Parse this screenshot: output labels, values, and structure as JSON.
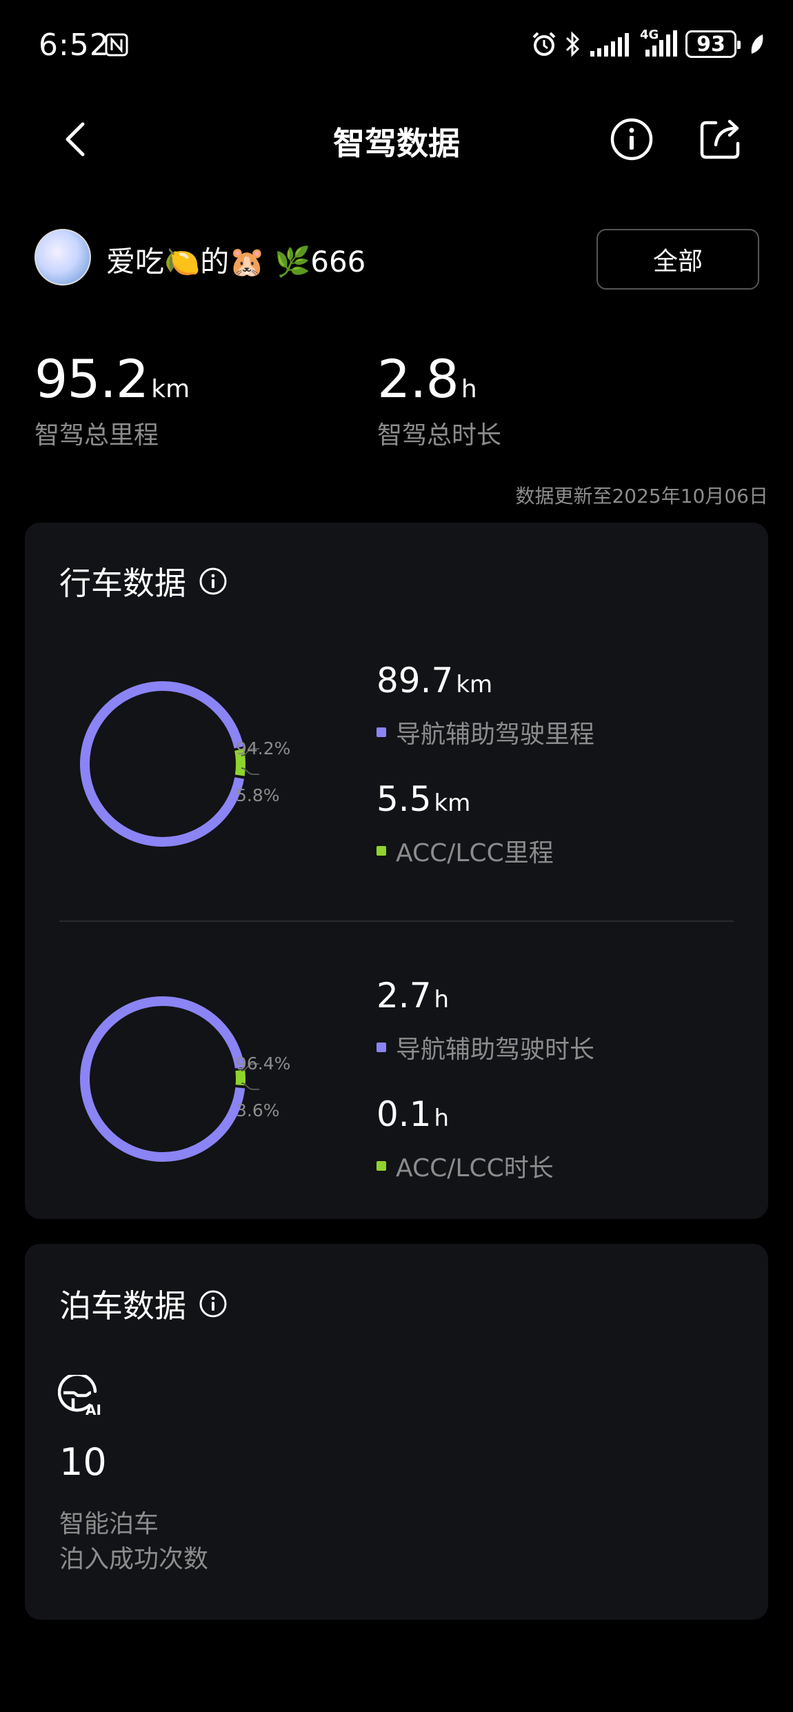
{
  "status_bar": {
    "time": "6:52",
    "battery": "93",
    "network": "4G"
  },
  "header": {
    "title": "智驾数据"
  },
  "profile": {
    "username": "爱吃🍋的🐹 🌿666",
    "scope_button": "全部"
  },
  "totals": {
    "mileage_value": "95.2",
    "mileage_unit": "km",
    "mileage_label": "智驾总里程",
    "duration_value": "2.8",
    "duration_unit": "h",
    "duration_label": "智驾总时长"
  },
  "updated_text": "数据更新至2025年10月06日",
  "driving": {
    "title": "行车数据",
    "mileage": {
      "nav_pct": "94.2%",
      "acc_pct": "5.8%",
      "nav_value": "89.7",
      "nav_unit": "km",
      "nav_label": "导航辅助驾驶里程",
      "acc_value": "5.5",
      "acc_unit": "km",
      "acc_label": "ACC/LCC里程",
      "nav_fraction": 0.942
    },
    "duration": {
      "nav_pct": "96.4%",
      "acc_pct": "3.6%",
      "nav_value": "2.7",
      "nav_unit": "h",
      "nav_label": "导航辅助驾驶时长",
      "acc_value": "0.1",
      "acc_unit": "h",
      "acc_label": "ACC/LCC时长",
      "nav_fraction": 0.964
    }
  },
  "parking": {
    "title": "泊车数据",
    "count": "10",
    "label_1": "智能泊车",
    "label_2": "泊入成功次数"
  },
  "colors": {
    "nav": "#8B84F5",
    "acc": "#8FD32E",
    "background": "#000000",
    "card": "#121316"
  },
  "icons": [
    "nfc-icon",
    "alarm-icon",
    "bluetooth-icon",
    "signal-icon",
    "back-icon",
    "info-icon",
    "share-icon",
    "steering-ai-icon"
  ]
}
